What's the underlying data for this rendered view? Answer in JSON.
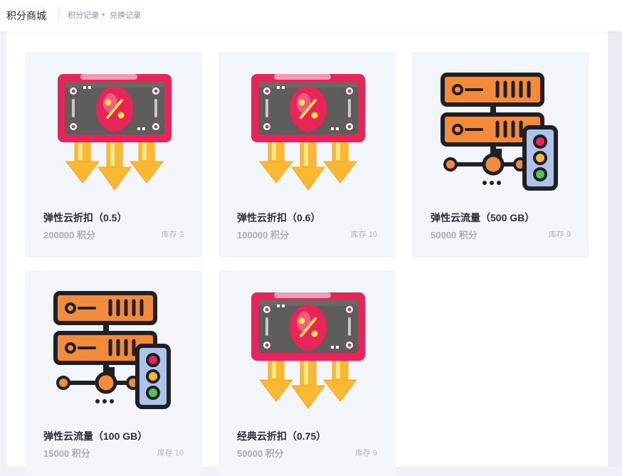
{
  "header": {
    "title": "积分商城",
    "nav": [
      {
        "label": "积分记录"
      },
      {
        "label": "兑换记录"
      }
    ]
  },
  "products": [
    {
      "name": "弹性云折扣（0.5）",
      "points": "200000 积分",
      "stock": "库存 2",
      "icon": "discount-coupon-icon"
    },
    {
      "name": "弹性云折扣（0.6）",
      "points": "100000 积分",
      "stock": "库存 10",
      "icon": "discount-coupon-icon"
    },
    {
      "name": "弹性云流量（500 GB）",
      "points": "50000 积分",
      "stock": "库存 9",
      "icon": "server-traffic-icon"
    },
    {
      "name": "弹性云流量（100 GB）",
      "points": "15000 积分",
      "stock": "库存 10",
      "icon": "server-traffic-icon"
    },
    {
      "name": "经典云折扣（0.75）",
      "points": "50000 积分",
      "stock": "库存 9",
      "icon": "discount-coupon-icon"
    }
  ],
  "colors": {
    "card_bg": "#f2f5f9",
    "coupon_pink": "#e8245a",
    "arrow_yellow": "#fbb832",
    "server_orange": "#f28c3c"
  }
}
